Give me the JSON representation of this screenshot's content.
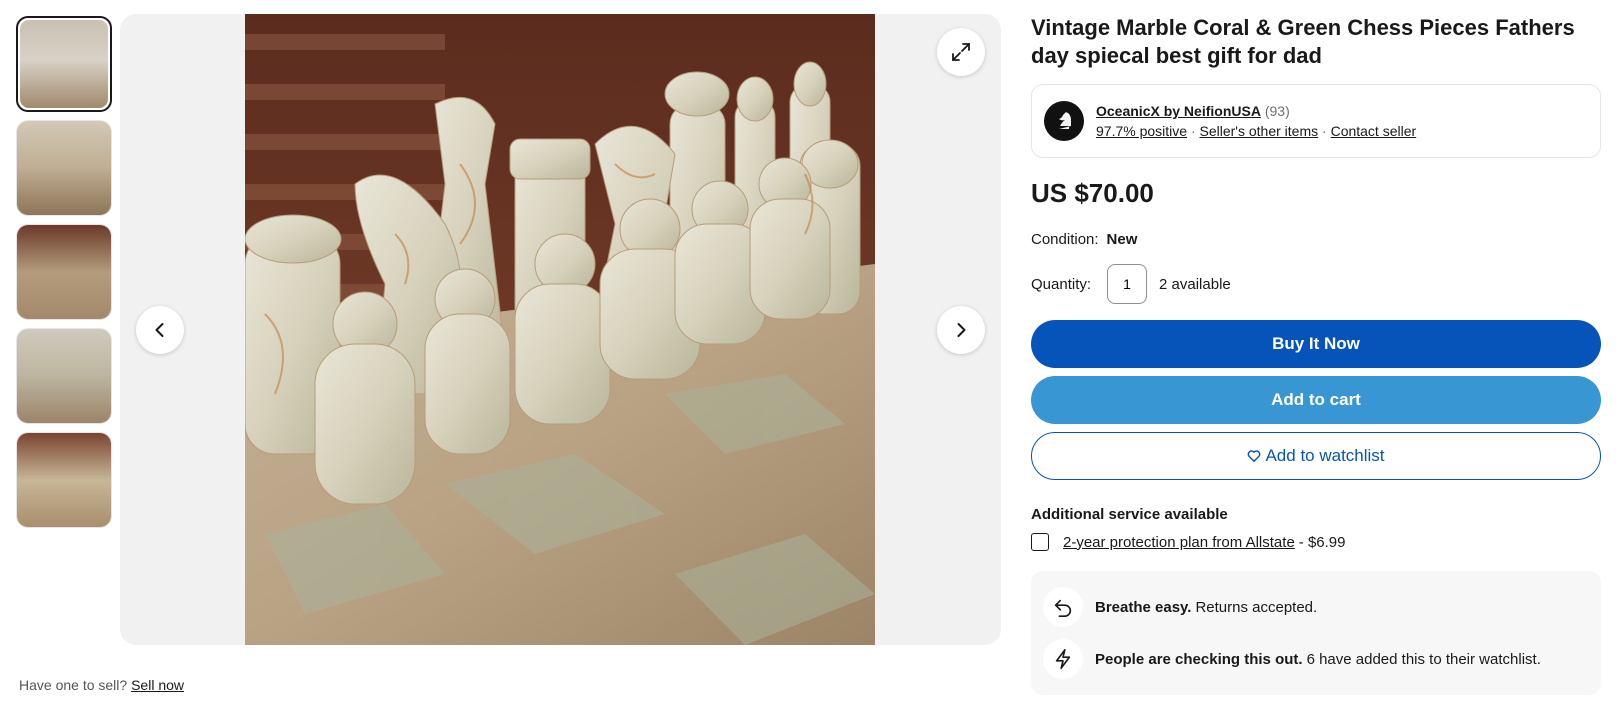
{
  "thumbnails": [
    {
      "name": "thumb-1"
    },
    {
      "name": "thumb-2"
    },
    {
      "name": "thumb-3"
    },
    {
      "name": "thumb-4"
    },
    {
      "name": "thumb-5"
    }
  ],
  "gallery": {
    "prev_icon": "chevron-left-icon",
    "next_icon": "chevron-right-icon",
    "expand_icon": "expand-icon"
  },
  "sell": {
    "prompt": "Have one to sell?",
    "link": "Sell now"
  },
  "listing": {
    "title": "Vintage Marble Coral & Green Chess Pieces Fathers day spiecal best gift for dad",
    "price": "US $70.00",
    "condition_label": "Condition:",
    "condition_value": "New",
    "quantity_label": "Quantity:",
    "quantity_value": "1",
    "available": "2 available"
  },
  "seller": {
    "name": "OceanicX by NeifionUSA",
    "feedback_count": "(93)",
    "positive": "97.7% positive",
    "other_items": "Seller's other items",
    "contact": "Contact seller",
    "separator": "·"
  },
  "buttons": {
    "buy": "Buy It Now",
    "cart": "Add to cart",
    "watch": "Add to watchlist"
  },
  "services": {
    "heading": "Additional service available",
    "plan_link": "2-year protection plan from Allstate",
    "plan_price": "- $6.99"
  },
  "info": {
    "returns_strong": "Breathe easy.",
    "returns_text": "Returns accepted.",
    "watch_strong": "People are checking this out.",
    "watch_text": "6 have added this to their watchlist."
  },
  "colors": {
    "primary": "#0654ba",
    "secondary": "#3896d3"
  }
}
